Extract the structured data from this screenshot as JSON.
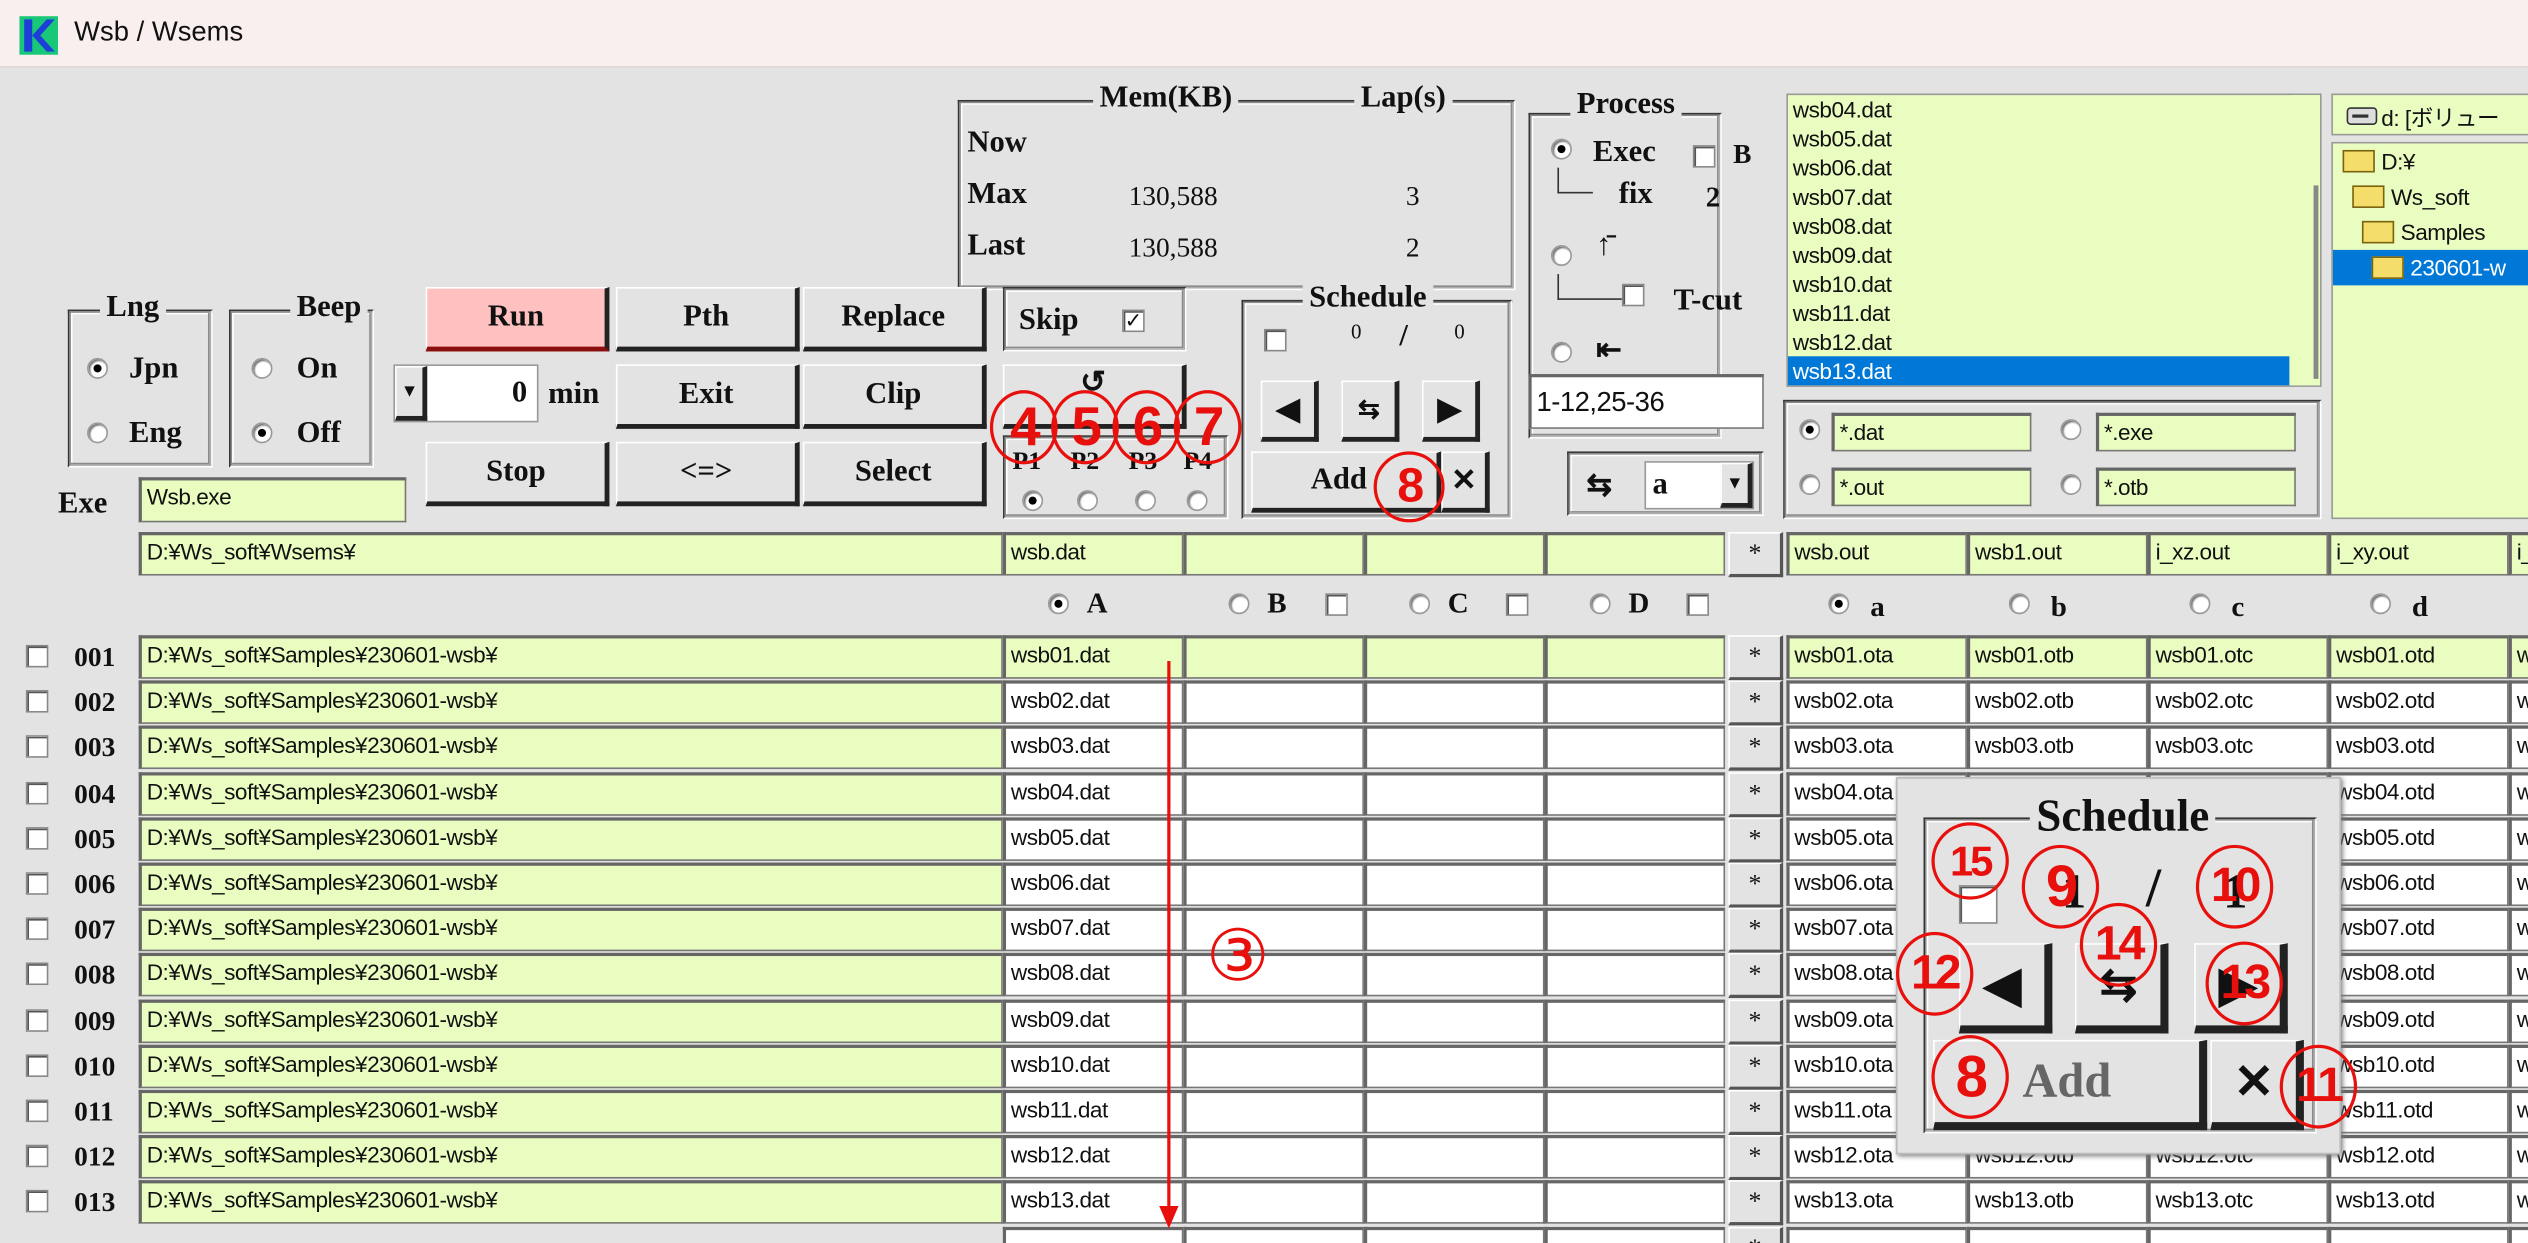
{
  "window": {
    "title": "Wsb / Wsems"
  },
  "mem": {
    "header": "Mem(KB)",
    "lap_header": "Lap(s)",
    "rows": [
      {
        "label": "Now",
        "mem": "",
        "lap": ""
      },
      {
        "label": "Max",
        "mem": "130,588",
        "lap": "3"
      },
      {
        "label": "Last",
        "mem": "130,588",
        "lap": "2"
      }
    ]
  },
  "process": {
    "title": "Process",
    "exec": "Exec",
    "b": "B",
    "fix": "fix",
    "fix_value": "2",
    "top_icon": "↑̄",
    "tcut": "T-cut",
    "back_icon": "⇤",
    "range": "1-12,25-36"
  },
  "lng": {
    "title": "Lng",
    "jpn": "Jpn",
    "eng": "Eng"
  },
  "beep": {
    "title": "Beep",
    "on": "On",
    "off": "Off"
  },
  "buttons": {
    "run": "Run",
    "pth": "Pth",
    "replace": "Replace",
    "exit": "Exit",
    "clip": "Clip",
    "stop": "Stop",
    "swap": "<=>",
    "select": "Select"
  },
  "timer": {
    "value": "0",
    "unit": "min"
  },
  "skip": {
    "label": "Skip",
    "checked": true
  },
  "p": {
    "labels": [
      "P1",
      "P2",
      "P3",
      "P4"
    ],
    "selected": 0
  },
  "schedule": {
    "title": "Schedule",
    "current": "0",
    "sep": "/",
    "total": "0",
    "add": "Add",
    "delete": "✕"
  },
  "column_combo": {
    "value": "a"
  },
  "exe": {
    "label": "Exe",
    "value": "Wsb.exe"
  },
  "file_list": {
    "items": [
      "wsb04.dat",
      "wsb05.dat",
      "wsb06.dat",
      "wsb07.dat",
      "wsb08.dat",
      "wsb09.dat",
      "wsb10.dat",
      "wsb11.dat",
      "wsb12.dat",
      "wsb13.dat"
    ],
    "selected": "wsb13.dat"
  },
  "filters": [
    "*.dat",
    "*.exe",
    "*.out",
    "*.otb"
  ],
  "drive": {
    "label": "d: [ボリュー"
  },
  "tree": [
    "D:¥",
    "Ws_soft",
    "Samples",
    "230601-w"
  ],
  "grid": {
    "exe_path": "D:¥Ws_soft¥Wsems¥",
    "input_headers": [
      "wsb.dat",
      "",
      "",
      ""
    ],
    "input_cols": [
      "A",
      "B",
      "C",
      "D"
    ],
    "star": "*",
    "output_headers": [
      "wsb.out",
      "wsb1.out",
      "i_xz.out",
      "i_xy.out",
      "i_"
    ],
    "output_cols": [
      "a",
      "b",
      "c",
      "d"
    ],
    "rows": [
      {
        "no": "001",
        "path": "D:¥Ws_soft¥Samples¥230601-wsb¥",
        "A": "wsb01.dat",
        "out": [
          "wsb01.ota",
          "wsb01.otb",
          "wsb01.otc",
          "wsb01.otd",
          "w"
        ]
      },
      {
        "no": "002",
        "path": "D:¥Ws_soft¥Samples¥230601-wsb¥",
        "A": "wsb02.dat",
        "out": [
          "wsb02.ota",
          "wsb02.otb",
          "wsb02.otc",
          "wsb02.otd",
          "w"
        ]
      },
      {
        "no": "003",
        "path": "D:¥Ws_soft¥Samples¥230601-wsb¥",
        "A": "wsb03.dat",
        "out": [
          "wsb03.ota",
          "wsb03.otb",
          "wsb03.otc",
          "wsb03.otd",
          "w"
        ]
      },
      {
        "no": "004",
        "path": "D:¥Ws_soft¥Samples¥230601-wsb¥",
        "A": "wsb04.dat",
        "out": [
          "wsb04.ota",
          "wsb04.otb",
          "wsb04.otc",
          "wsb04.otd",
          "w"
        ]
      },
      {
        "no": "005",
        "path": "D:¥Ws_soft¥Samples¥230601-wsb¥",
        "A": "wsb05.dat",
        "out": [
          "wsb05.ota",
          "wsb05.otb",
          "wsb05.otc",
          "wsb05.otd",
          "w"
        ]
      },
      {
        "no": "006",
        "path": "D:¥Ws_soft¥Samples¥230601-wsb¥",
        "A": "wsb06.dat",
        "out": [
          "wsb06.ota",
          "wsb06.otb",
          "wsb06.otc",
          "wsb06.otd",
          "w"
        ]
      },
      {
        "no": "007",
        "path": "D:¥Ws_soft¥Samples¥230601-wsb¥",
        "A": "wsb07.dat",
        "out": [
          "wsb07.ota",
          "wsb07.otb",
          "wsb07.otc",
          "wsb07.otd",
          "w"
        ]
      },
      {
        "no": "008",
        "path": "D:¥Ws_soft¥Samples¥230601-wsb¥",
        "A": "wsb08.dat",
        "out": [
          "wsb08.ota",
          "wsb08.otb",
          "wsb08.otc",
          "wsb08.otd",
          "w"
        ]
      },
      {
        "no": "009",
        "path": "D:¥Ws_soft¥Samples¥230601-wsb¥",
        "A": "wsb09.dat",
        "out": [
          "wsb09.ota",
          "wsb09.otb",
          "wsb09.otc",
          "wsb09.otd",
          "w"
        ]
      },
      {
        "no": "010",
        "path": "D:¥Ws_soft¥Samples¥230601-wsb¥",
        "A": "wsb10.dat",
        "out": [
          "wsb10.ota",
          "wsb10.otb",
          "wsb10.otc",
          "wsb10.otd",
          "w"
        ]
      },
      {
        "no": "011",
        "path": "D:¥Ws_soft¥Samples¥230601-wsb¥",
        "A": "wsb11.dat",
        "out": [
          "wsb11.ota",
          "wsb11.otb",
          "wsb11.otc",
          "wsb11.otd",
          "w"
        ]
      },
      {
        "no": "012",
        "path": "D:¥Ws_soft¥Samples¥230601-wsb¥",
        "A": "wsb12.dat",
        "out": [
          "wsb12.ota",
          "wsb12.otb",
          "wsb12.otc",
          "wsb12.otd",
          "w"
        ]
      },
      {
        "no": "013",
        "path": "D:¥Ws_soft¥Samples¥230601-wsb¥",
        "A": "wsb13.dat",
        "out": [
          "wsb13.ota",
          "wsb13.otb",
          "wsb13.otc",
          "wsb13.otd",
          "w"
        ]
      }
    ]
  },
  "popup": {
    "title": "Schedule",
    "current": "1",
    "sep": "/",
    "total": "1",
    "add": "Add",
    "delete": "✕"
  },
  "annotations": {
    "m3": "③",
    "m4": "4",
    "m5": "5",
    "m6": "6",
    "m7": "7",
    "m8": "8",
    "m8b": "8",
    "m9": "9",
    "m10": "10",
    "m11": "11",
    "m12": "12",
    "m13": "13",
    "m14": "14",
    "m15": "15"
  },
  "colors": {
    "field": "#e9fdc0",
    "run": "#ffc0c0",
    "selection": "#0078d7",
    "annotation": "#e8100c"
  }
}
